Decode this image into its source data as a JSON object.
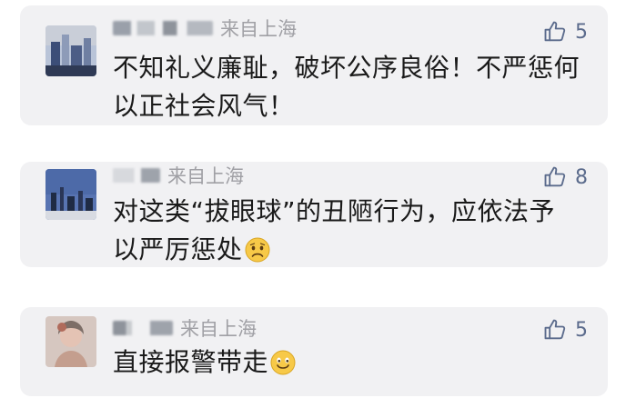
{
  "comments": [
    {
      "location": "来自上海",
      "likes": "5",
      "text": "不知礼义廉耻，破坏公序良俗！不严惩何以正社会风气！",
      "emoji": "",
      "avatar_colors": [
        "#3c4e78",
        "#8d9bb8",
        "#c9ced8"
      ]
    },
    {
      "location": "来自上海",
      "likes": "8",
      "text": "对这类“拔眼球”的丑陋行为，应依法予以严厉惩处",
      "emoji": "sad-face-icon",
      "avatar_colors": [
        "#4d6aa8",
        "#1f2b44",
        "#d8dbe2"
      ]
    },
    {
      "location": "来自上海",
      "likes": "5",
      "text": "直接报警带走",
      "emoji": "smile-face-icon",
      "avatar_colors": [
        "#d6c7c0",
        "#b06b5b",
        "#7d6e67"
      ]
    }
  ],
  "colors": {
    "card_bg": "#f1f1f3",
    "meta_text": "#a0a0a5",
    "like_icon": "#5b6b8c",
    "body_text": "#1a1a1a"
  }
}
